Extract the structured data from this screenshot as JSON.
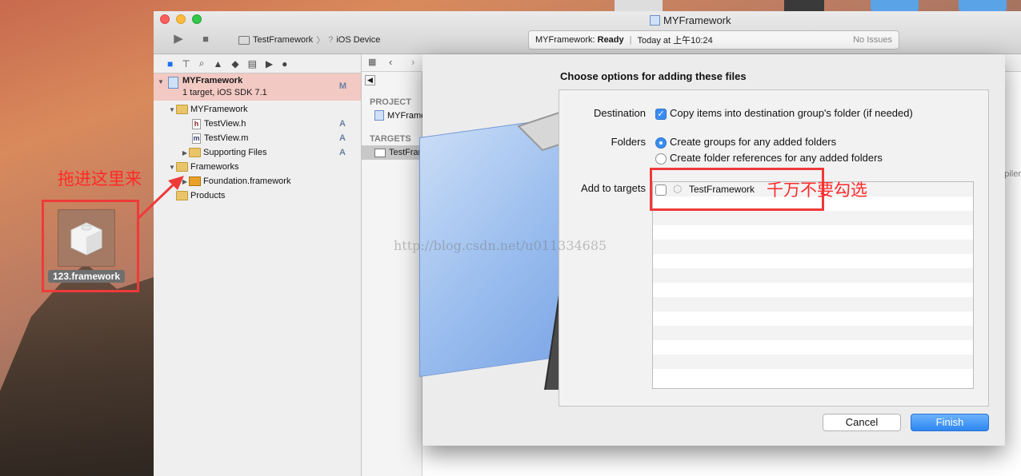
{
  "desktop": {
    "framework_icon_label": "123.framework",
    "annotation_drag": "拖进这里来",
    "annotation_target": "千万不要勾选"
  },
  "window": {
    "title": "MYFramework",
    "scheme": "TestFramework",
    "device": "iOS Device",
    "activity_project": "MYFramework:",
    "activity_status": "Ready",
    "activity_time": "Today at 上午10:24",
    "activity_issues": "No Issues"
  },
  "navigator": {
    "project_name": "MYFramework",
    "project_sub": "1 target, iOS SDK 7.1",
    "project_status": "M",
    "items": [
      {
        "label": "MYFramework",
        "status": ""
      },
      {
        "label": "TestView.h",
        "status": "A"
      },
      {
        "label": "TestView.m",
        "status": "A"
      },
      {
        "label": "Supporting Files",
        "status": "A"
      },
      {
        "label": "Frameworks",
        "status": ""
      },
      {
        "label": "Foundation.framework",
        "status": ""
      },
      {
        "label": "Products",
        "status": ""
      }
    ]
  },
  "editor": {
    "project_header": "PROJECT",
    "project_item": "MYFramework",
    "targets_header": "TARGETS",
    "target_item": "TestFramework",
    "right_fragment": "piler"
  },
  "dialog": {
    "title": "Choose options for adding these files",
    "destination_label": "Destination",
    "destination_option": "Copy items into destination group's folder (if needed)",
    "folders_label": "Folders",
    "folders_option_1": "Create groups for any added folders",
    "folders_option_2": "Create folder references for any added folders",
    "targets_label": "Add to targets",
    "target_name": "TestFramework",
    "cancel": "Cancel",
    "finish": "Finish"
  },
  "watermark": "http://blog.csdn.net/u011334685"
}
